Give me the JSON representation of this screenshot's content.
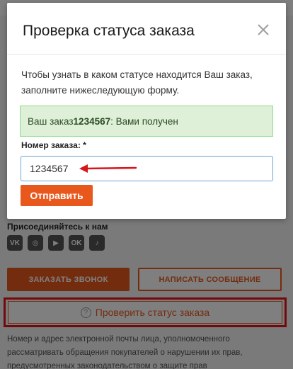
{
  "background": {
    "social_title": "Присоединяйтесь к нам",
    "social_icons": [
      {
        "name": "vk-icon",
        "glyph": "VK"
      },
      {
        "name": "instagram-icon",
        "glyph": "◎"
      },
      {
        "name": "youtube-icon",
        "glyph": "▶"
      },
      {
        "name": "odnoklassniki-icon",
        "glyph": "OK"
      },
      {
        "name": "tiktok-icon",
        "glyph": "♪"
      }
    ],
    "call_button": "ЗАКАЗАТЬ ЗВОНОК",
    "message_button": "НАПИСАТЬ СООБЩЕНИЕ",
    "status_button": "Проверить статус заказа",
    "status_icon_glyph": "?",
    "footer_text": "Номер и адрес электронной почты лица, уполномоченного рассматривать обращения покупателей о нарушении их прав, предусмотренных законодательством о защите прав"
  },
  "modal": {
    "title": "Проверка статуса заказа",
    "description": "Чтобы узнать в каком статусе находится Ваш заказ, заполните нижеследующую форму.",
    "alert": {
      "prefix": "Ваш заказ ",
      "order_number": "1234567",
      "suffix": ": Вами получен"
    },
    "field_label": "Номер заказа: *",
    "order_input_value": "1234567",
    "submit_label": "Отправить"
  },
  "colors": {
    "accent": "#e8581c",
    "success_bg": "#dff0d8",
    "success_border": "#8fdc8c",
    "highlight_red": "#e5131b",
    "input_border": "#6aa4d8"
  }
}
